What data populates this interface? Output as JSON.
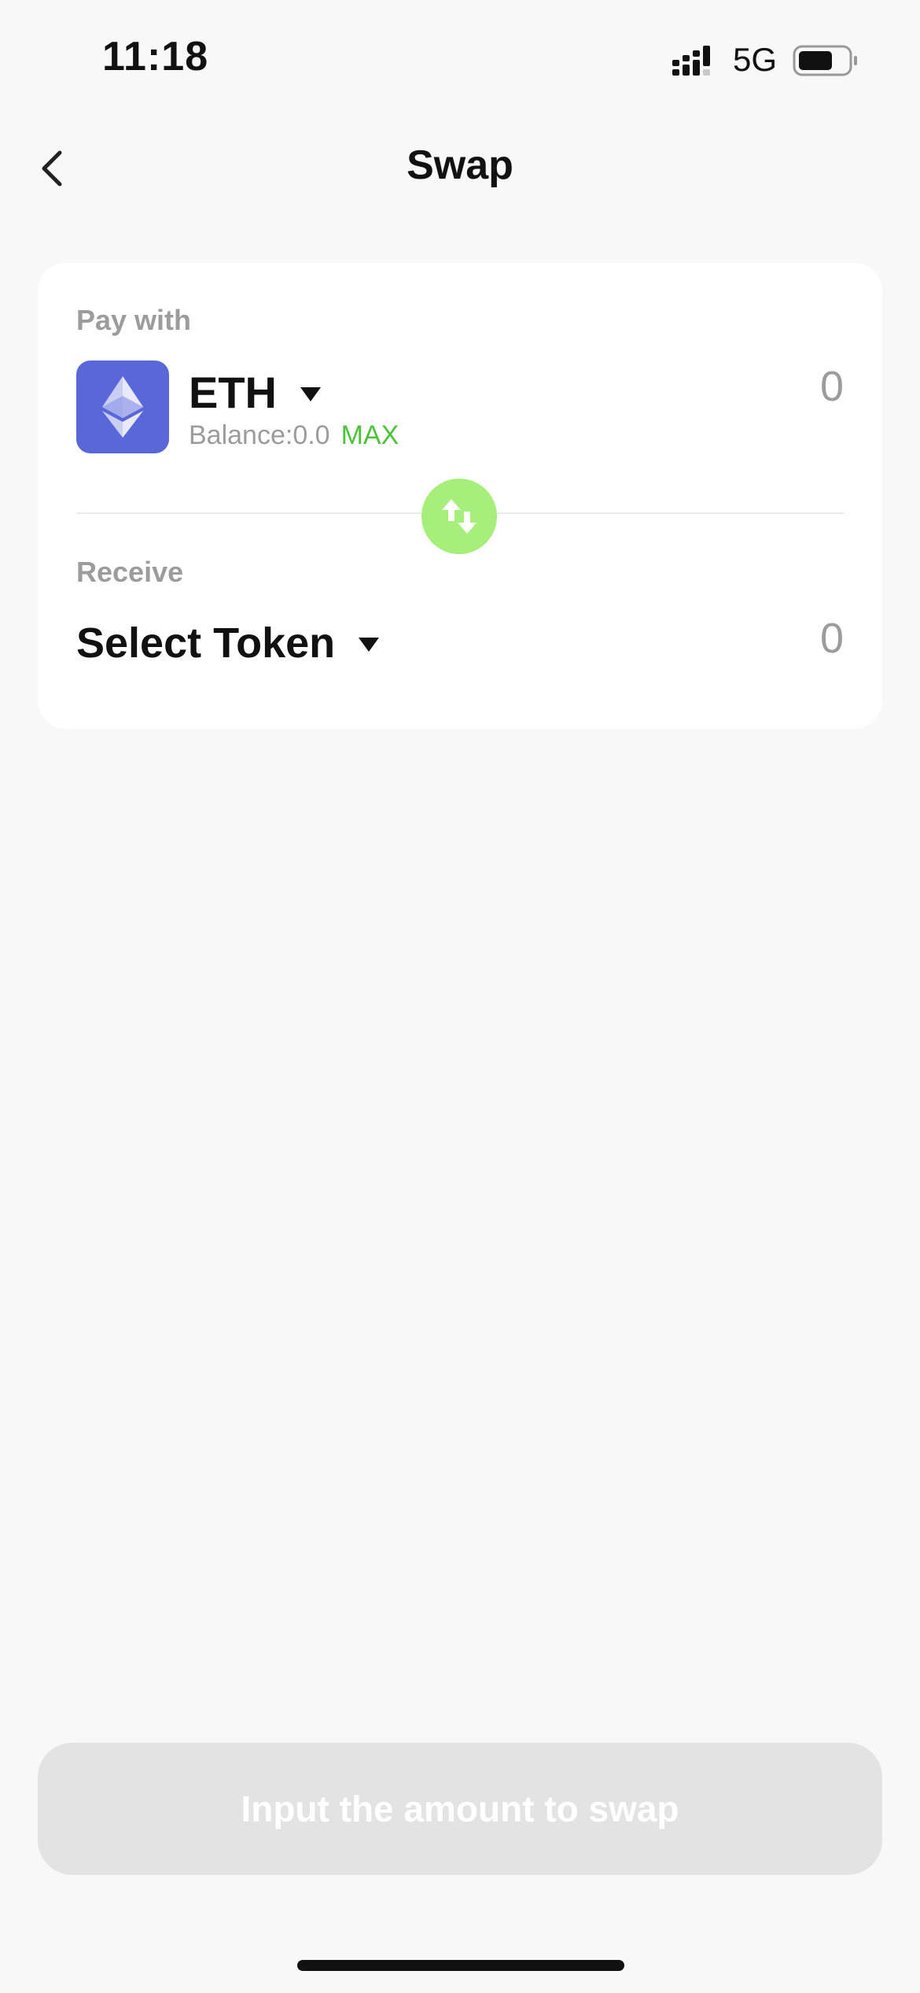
{
  "status_bar": {
    "time": "11:18",
    "network": "5G",
    "signal_icon": "signal-icon",
    "battery_icon": "battery-icon"
  },
  "nav": {
    "title": "Swap",
    "back_icon": "chevron-left-icon"
  },
  "pay": {
    "label": "Pay with",
    "token_symbol": "ETH",
    "token_icon": "ethereum-icon",
    "balance_text": "Balance:0.0",
    "max_label": "MAX",
    "amount": "0"
  },
  "receive": {
    "label": "Receive",
    "select_label": "Select Token",
    "amount": "0"
  },
  "swap_direction_icon": "swap-arrows-icon",
  "action_button": {
    "label": "Input the amount to swap"
  },
  "colors": {
    "accent_green": "#a6f07a",
    "max_green": "#4cc43a",
    "eth_blue": "#5a67d8",
    "muted_text": "#9c9c9c",
    "button_disabled": "#e3e3e3"
  }
}
